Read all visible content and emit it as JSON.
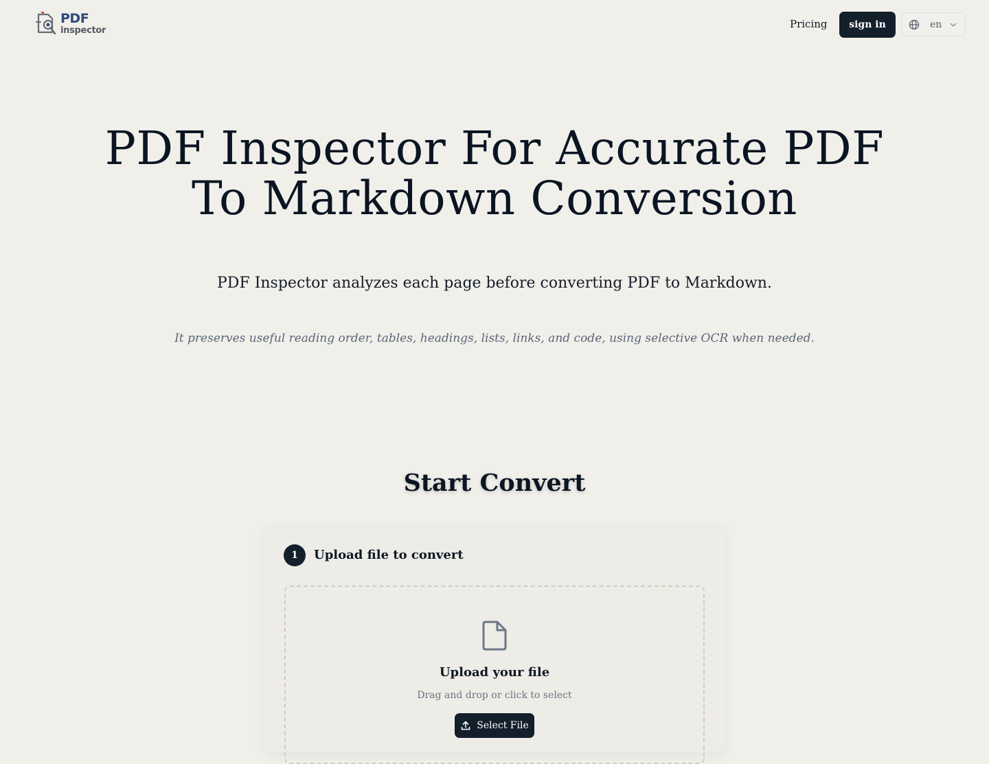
{
  "header": {
    "logo": {
      "word_1": "PDF",
      "word_2": "inspector",
      "icon": "pdf-magnifier-logo-icon"
    },
    "nav": {
      "pricing_label": "Pricing",
      "signin_label": "sign in"
    },
    "language": {
      "icon": "globe-icon",
      "value": "en",
      "dropdown_icon": "chevron-down-icon"
    }
  },
  "hero": {
    "title": "PDF Inspector For Accurate PDF To Markdown Conversion",
    "subtitle": "PDF Inspector analyzes each page before converting PDF to Markdown.",
    "note": "It preserves useful reading order, tables, headings, lists, links, and code, using selective OCR when needed."
  },
  "convert": {
    "section_title": "Start Convert",
    "step": {
      "number": "1",
      "title": "Upload file to convert"
    },
    "dropzone": {
      "icon": "file-icon",
      "title": "Upload your file",
      "hint": "Drag and drop or click to select",
      "button_label": "Select File",
      "button_icon": "upload-icon"
    }
  },
  "colors": {
    "background": "#f0efea",
    "text_primary": "#0b1422",
    "button_dark": "#141f2c",
    "logo_blue": "#2f4b7c",
    "muted_text": "#5b6677"
  }
}
